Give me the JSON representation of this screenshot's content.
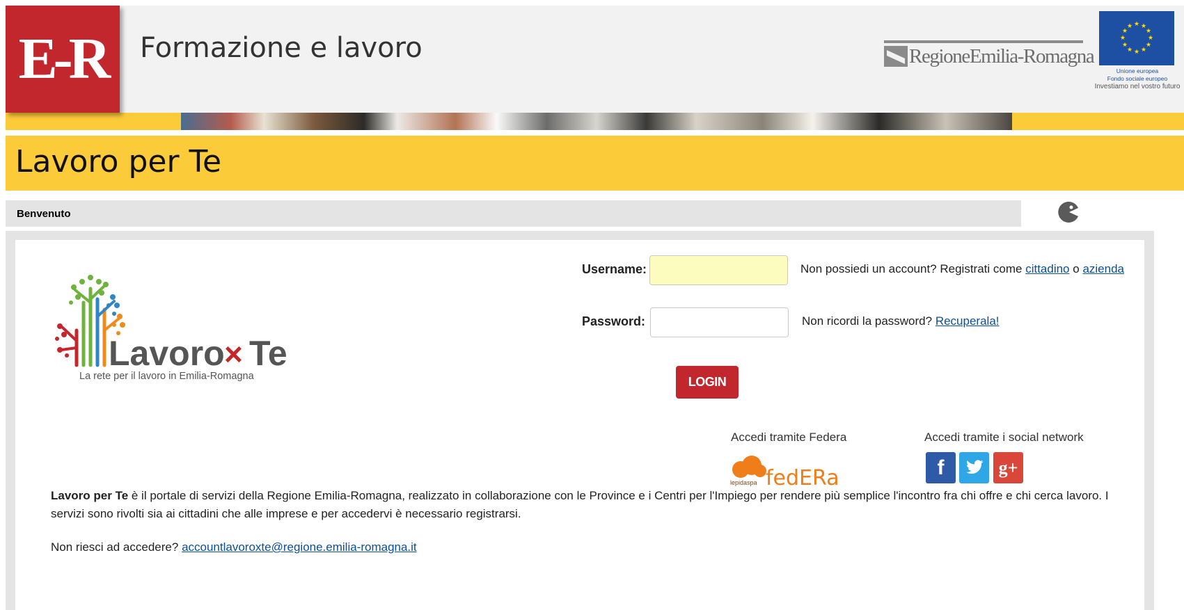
{
  "header": {
    "logo_text": "E-R",
    "site_title": "Formazione e lavoro",
    "region_logo_text": "RegioneEmilia-Romagna",
    "eu_caption_1": "Unione europea",
    "eu_caption_2": "Fondo sociale europeo",
    "eu_caption_3": "Investiamo nel vostro futuro"
  },
  "page": {
    "title": "Lavoro per Te"
  },
  "breadcrumb": {
    "label": "Benvenuto"
  },
  "app_logo": {
    "name_part_1": "Lavoro",
    "name_part_2": "Te",
    "tagline": "La rete per il lavoro in Emilia-Romagna"
  },
  "login_form": {
    "username_label": "Username:",
    "username_value": "",
    "password_label": "Password:",
    "password_value": "",
    "no_account_text": "Non possiedi un account? Registrati come",
    "citizen_link": "cittadino",
    "or_text": "o",
    "company_link": "azienda",
    "forgot_text": "Non ricordi la password?",
    "recover_link": "Recuperala!",
    "login_button": "LOGIN"
  },
  "federa": {
    "caption": "Accedi tramite Federa",
    "logo_small": "lepidaspa",
    "logo_text": "fedERa"
  },
  "social": {
    "caption": "Accedi tramite i social network",
    "facebook_glyph": "f",
    "gplus_glyph": "g+"
  },
  "description": {
    "lead": "Lavoro per Te",
    "text": " è il portale di servizi della Regione Emilia-Romagna, realizzato in collaborazione con le Province e i Centri per l'Impiego per rendere più semplice l'incontro fra chi offre e chi cerca lavoro. I servizi sono rivolti sia ai cittadini che alle imprese e per accedervi è necessario registrarsi."
  },
  "help": {
    "text": "Non riesci ad accedere?",
    "email_link": "accountlavoroxte@regione.emilia-romagna.it"
  },
  "colors": {
    "brand_red": "#c1272d",
    "yellow": "#fccb3a",
    "eu_blue": "#1d4fa3",
    "link_blue": "#0b4f9a"
  }
}
